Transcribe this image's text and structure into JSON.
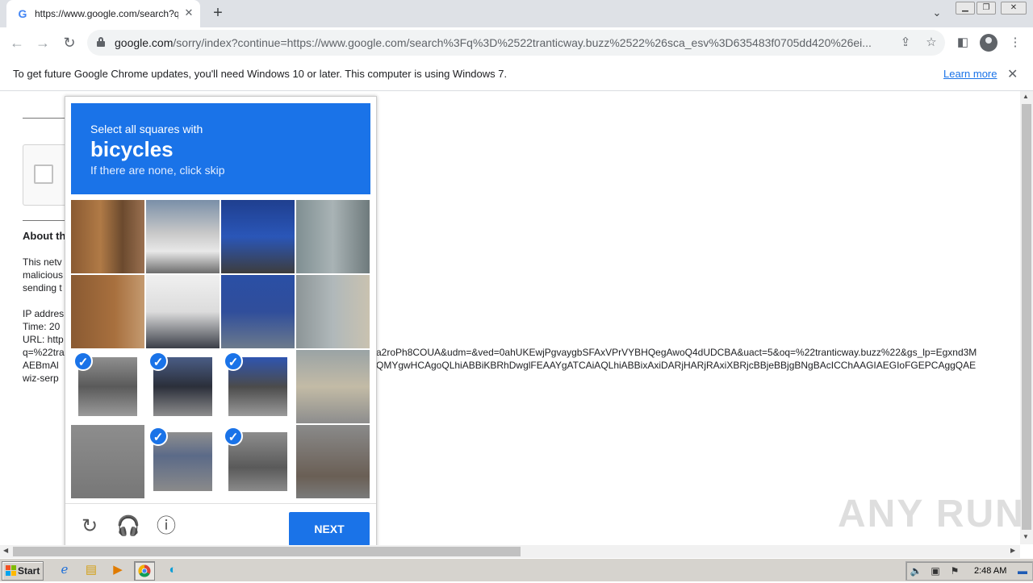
{
  "browser": {
    "tab_title": "https://www.google.com/search?q=",
    "tab_favicon": "G",
    "new_tab_label": "+",
    "url_host": "google.com",
    "url_rest": "/sorry/index?continue=https://www.google.com/search%3Fq%3D%2522tranticway.buzz%2522%26sca_esv%3D635483f0705dd420%26ei..."
  },
  "infobar": {
    "message": "To get future Google Chrome updates, you'll need Windows 10 or later. This computer is using Windows 7.",
    "learn_more": "Learn more"
  },
  "page": {
    "about_heading": "About th",
    "para": [
      "This netv",
      "malicious",
      "sending t"
    ],
    "ip_line": "IP addres",
    "time_line": "Time: 20",
    "url_line": "URL: http",
    "q_line": "q=%22tra",
    "q_line_right": "a2roPh8COUA&udm=&ved=0ahUKEwjPgvaygbSFAxVPrVYBHQegAwoQ4dUDCBA&uact=5&oq=%22tranticway.buzz%22&gs_lp=Egxnd3M",
    "ae_line": "AEBmAl",
    "ae_line_right": "QMYgwHCAgoQLhiABBiKBRhDwglFEAAYgATCAiAQLhiABBixAxiDARjHARjRAxiXBRjcBBjeBBjgBNgBAcICChAAGIAEGIoFGEPCAggQAE",
    "wiz_line": "wiz-serp"
  },
  "captcha": {
    "instruction_line1": "Select all squares with",
    "target": "bicycles",
    "instruction_line3": "If there are none, click skip",
    "selected_tiles": [
      8,
      9,
      10,
      13,
      14
    ],
    "next_label": "NEXT",
    "footer_icons": [
      "reload-icon",
      "audio-icon",
      "info-icon"
    ]
  },
  "watermark": "ANY RUN",
  "taskbar": {
    "start_label": "Start",
    "clock": "2:48 AM"
  }
}
